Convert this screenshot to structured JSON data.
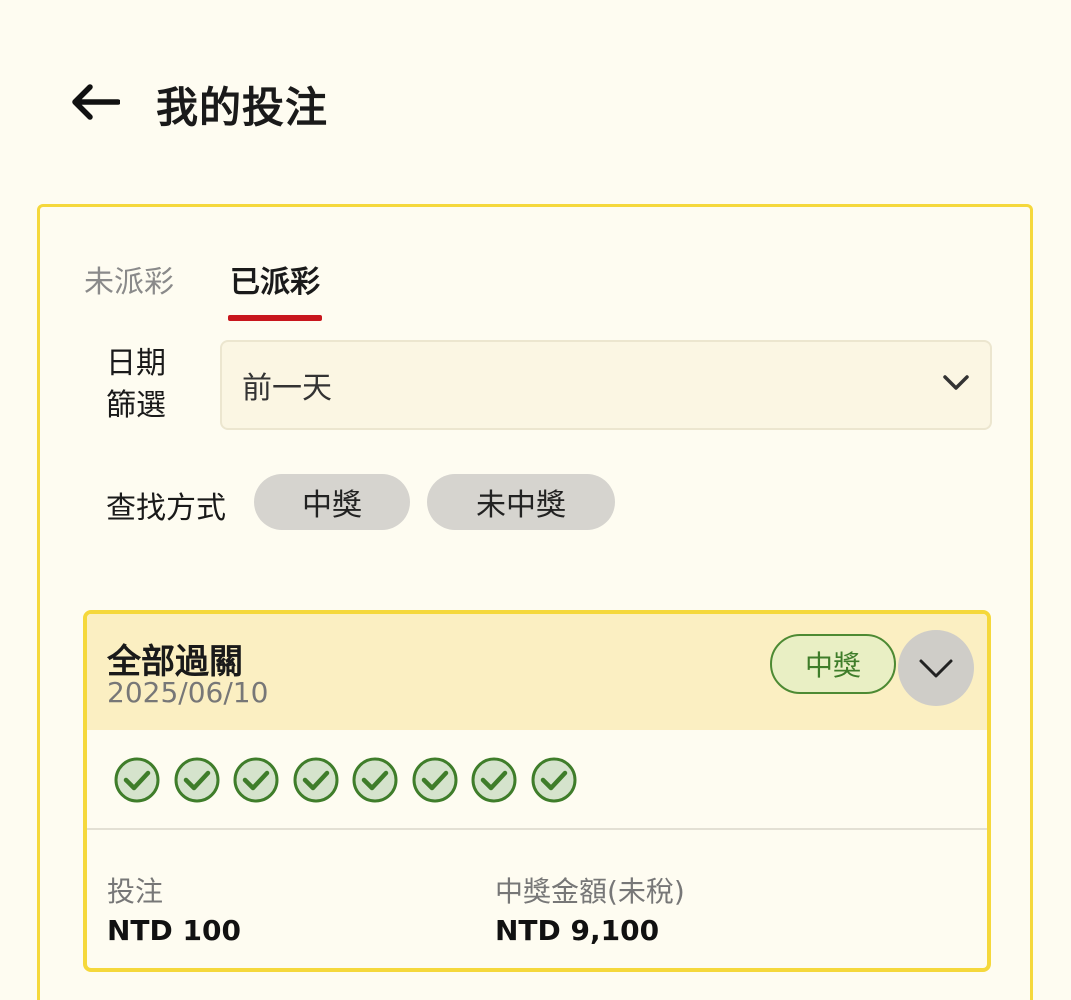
{
  "header": {
    "title": "我的投注",
    "back_icon": "arrow-left-icon"
  },
  "tabs": [
    {
      "label": "未派彩",
      "active": false
    },
    {
      "label": "已派彩",
      "active": true
    }
  ],
  "filters": {
    "date_label": "日期篩選",
    "date_value": "前一天",
    "search_label": "查找方式",
    "chips": [
      "中獎",
      "未中獎"
    ]
  },
  "bet": {
    "type": "全部過關",
    "date": "2025/06/10",
    "status_badge": "中獎",
    "legs_won": 8,
    "stake_label": "投注",
    "stake_value": "NTD 100",
    "payout_label": "中獎金額(未稅)",
    "payout_value": "NTD 9,100"
  },
  "colors": {
    "accent_yellow": "#f5d83c",
    "tab_underline": "#c8161d",
    "win_green": "#3f7d2a",
    "background": "#fefcf1"
  }
}
